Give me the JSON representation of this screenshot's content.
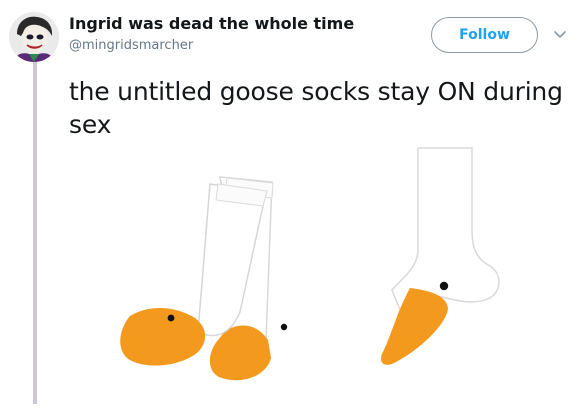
{
  "tweet": {
    "display_name": "Ingrid was dead the whole time",
    "handle": "@mingridsmarcher",
    "follow_label": "Follow",
    "text": "the untitled goose socks stay ON during sex"
  },
  "colors": {
    "follow_border": "#8e9aa3",
    "follow_text": "#1da1f2",
    "thread_line": "#cfc6d6",
    "sock_white": "#ffffff",
    "sock_orange": "#f39a1e"
  },
  "icons": {
    "avatar": "joker-avatar",
    "more": "chevron-down-icon"
  }
}
